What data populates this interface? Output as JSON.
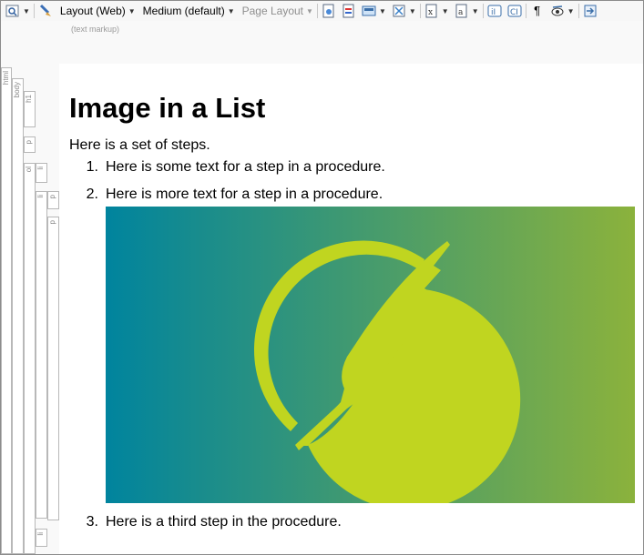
{
  "toolbar": {
    "layout_label": "Layout (Web)",
    "size_label": "Medium (default)",
    "page_layout_label": "Page Layout",
    "sub_label": "(text markup)",
    "icons": [
      "zoom-icon",
      "brush-icon",
      "preview-icon",
      "highlight-icon",
      "image-icon",
      "link-icon",
      "variable-icon",
      "snippet-icon",
      "condition-icon",
      "text-icon",
      "paragraph-icon",
      "eye-icon",
      "bind-icon"
    ]
  },
  "tags": {
    "html": "html",
    "body": "body",
    "h1": "h1",
    "p1": "p",
    "ol": "ol",
    "li1": "li",
    "p2": "p",
    "li2": "li",
    "p3": "p",
    "li3": "li"
  },
  "doc": {
    "title": "Image in a List",
    "intro": "Here is a set of steps.",
    "steps": [
      {
        "num": "1.",
        "text": "Here is some text for a step in a procedure."
      },
      {
        "num": "2.",
        "text": "Here is more text for a step in a procedure."
      },
      {
        "num": "3.",
        "text": "Here is a third step in the procedure."
      }
    ]
  },
  "colors": {
    "gradient_left": "#00849e",
    "gradient_right": "#8bb23c",
    "logo": "#c0d520"
  }
}
